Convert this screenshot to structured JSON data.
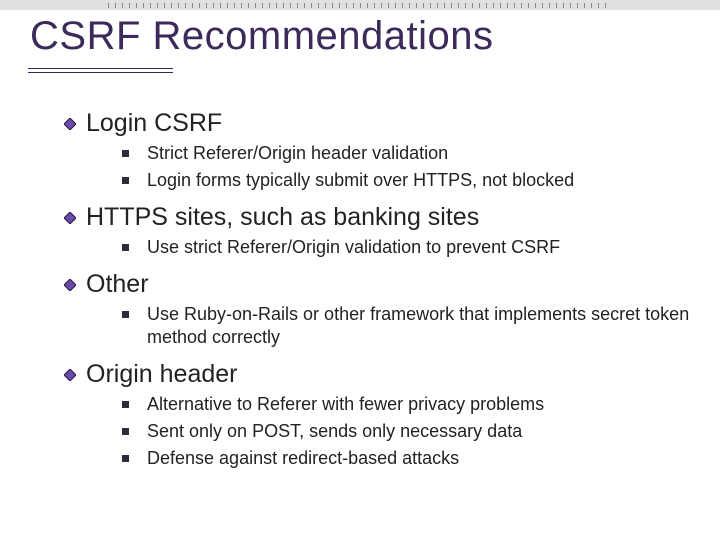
{
  "title": "CSRF Recommendations",
  "sections": [
    {
      "heading": "Login CSRF",
      "items": [
        "Strict Referer/Origin header validation",
        "Login forms typically submit over HTTPS, not blocked"
      ]
    },
    {
      "heading": "HTTPS sites, such as banking sites",
      "items": [
        "Use strict Referer/Origin validation to prevent CSRF"
      ]
    },
    {
      "heading": "Other",
      "items": [
        "Use Ruby-on-Rails or other framework that implements secret token method correctly"
      ]
    },
    {
      "heading": "Origin header",
      "items": [
        "Alternative to Referer with fewer privacy problems",
        "Sent only on POST, sends only necessary data",
        "Defense against redirect-based attacks"
      ]
    }
  ]
}
